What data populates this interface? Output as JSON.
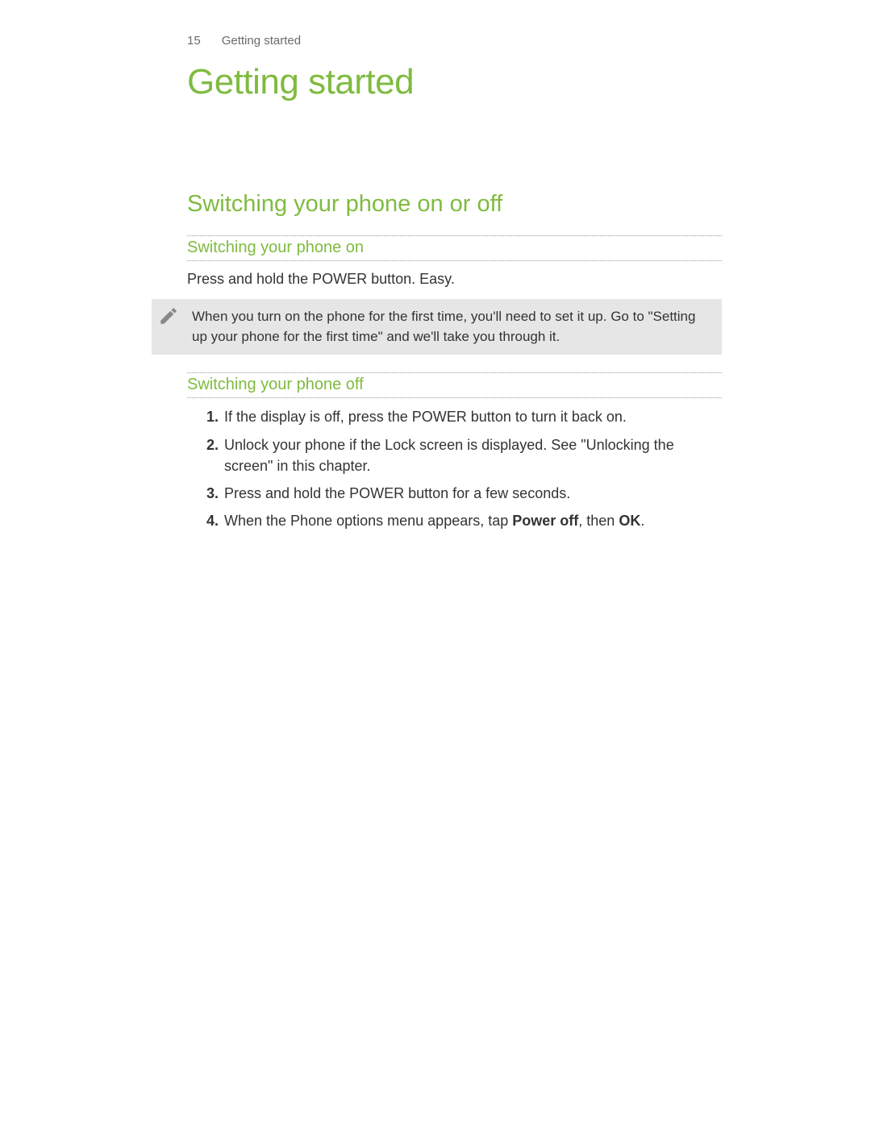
{
  "header": {
    "page_number": "15",
    "chapter_label": "Getting started"
  },
  "chapter_title": "Getting started",
  "section_title": "Switching your phone on or off",
  "sub_on": {
    "heading": "Switching your phone on",
    "body": "Press and hold the POWER button. Easy."
  },
  "note": {
    "text": "When you turn on the phone for the first time, you'll need to set it up. Go to \"Setting up your phone for the first time\" and we'll take you through it."
  },
  "sub_off": {
    "heading": "Switching your phone off",
    "steps": [
      "If the display is off, press the POWER button to turn it back on.",
      "Unlock your phone if the Lock screen is displayed. See \"Unlocking the screen\" in this chapter.",
      "Press and hold the POWER button for a few seconds."
    ],
    "step4_pre": "When the Phone options menu appears, tap ",
    "step4_bold1": "Power off",
    "step4_mid": ", then ",
    "step4_bold2": "OK",
    "step4_post": "."
  }
}
